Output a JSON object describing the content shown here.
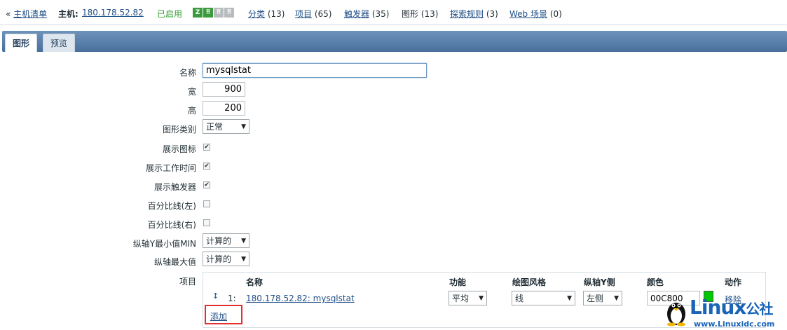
{
  "nav": {
    "back_link": "主机清单",
    "host_label": "主机:",
    "host_value": "180.178.52.82",
    "status": "已启用",
    "status_boxes": [
      "Z",
      "SNMP",
      "JMX",
      "IPMI"
    ],
    "links": [
      {
        "label": "分类",
        "count": "(13)"
      },
      {
        "label": "项目",
        "count": "(65)"
      },
      {
        "label": "触发器",
        "count": "(35)"
      },
      {
        "label": "图形",
        "count": "(13)"
      },
      {
        "label": "探索规则",
        "count": "(3)"
      },
      {
        "label": "Web 场景",
        "count": "(0)"
      }
    ]
  },
  "tabs": [
    {
      "label": "图形",
      "active": true
    },
    {
      "label": "预览",
      "active": false
    }
  ],
  "form": {
    "name_label": "名称",
    "name_value": "mysqlstat",
    "width_label": "宽",
    "width_value": "900",
    "height_label": "高",
    "height_value": "200",
    "graph_type_label": "图形类别",
    "graph_type_value": "正常",
    "show_legend_label": "展示图标",
    "show_worktime_label": "展示工作时间",
    "show_triggers_label": "展示触发器",
    "percentile_left_label": "百分比线(左)",
    "percentile_right_label": "百分比线(右)",
    "ymin_label": "纵轴Y最小值MIN",
    "ymin_value": "计算的",
    "ymax_label": "纵轴最大值",
    "ymax_value": "计算的",
    "items_label": "项目"
  },
  "checkboxes": {
    "show_legend": true,
    "show_worktime": true,
    "show_triggers": true,
    "percentile_left": false,
    "percentile_right": false
  },
  "items_table": {
    "headers": {
      "name": "名称",
      "function": "功能",
      "draw_style": "绘图风格",
      "y_axis_side": "纵轴Y侧",
      "color": "颜色",
      "action": "动作"
    },
    "rows": [
      {
        "index": "1:",
        "name": "180.178.52.82: mysqlstat",
        "function": "平均",
        "draw_style": "线",
        "y_axis_side": "左侧",
        "color": "00C800",
        "action": "移除"
      }
    ],
    "add_label": "添加"
  },
  "colors": {
    "tab_strip": "#5a80ad",
    "link": "#1f4f86",
    "status_green": "#2f9d2f",
    "swatch": "#00c800",
    "highlight_box": "#e03030"
  },
  "watermark": {
    "brand": "Linux",
    "brand_cn": "公社",
    "url": "www.Linuxidc.com"
  }
}
